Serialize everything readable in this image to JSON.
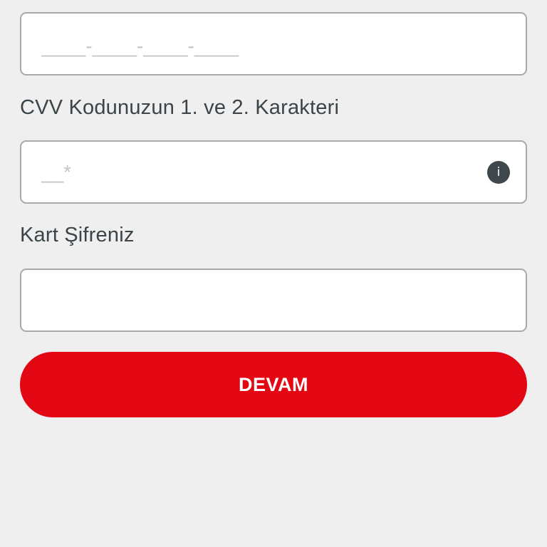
{
  "card_number": {
    "value": "",
    "placeholder": "____-____-____-____"
  },
  "cvv": {
    "label": "CVV Kodunuzun 1. ve 2. Karakteri",
    "value": "",
    "placeholder": "__*",
    "info_icon": "info-icon"
  },
  "pin": {
    "label": "Kart Şifreniz",
    "value": "",
    "placeholder": ""
  },
  "continue_button": {
    "label": "DEVAM",
    "color": "#e30613"
  },
  "colors": {
    "background": "#efefef",
    "label_text": "#3b4448",
    "field_border": "#a9a9a9"
  }
}
